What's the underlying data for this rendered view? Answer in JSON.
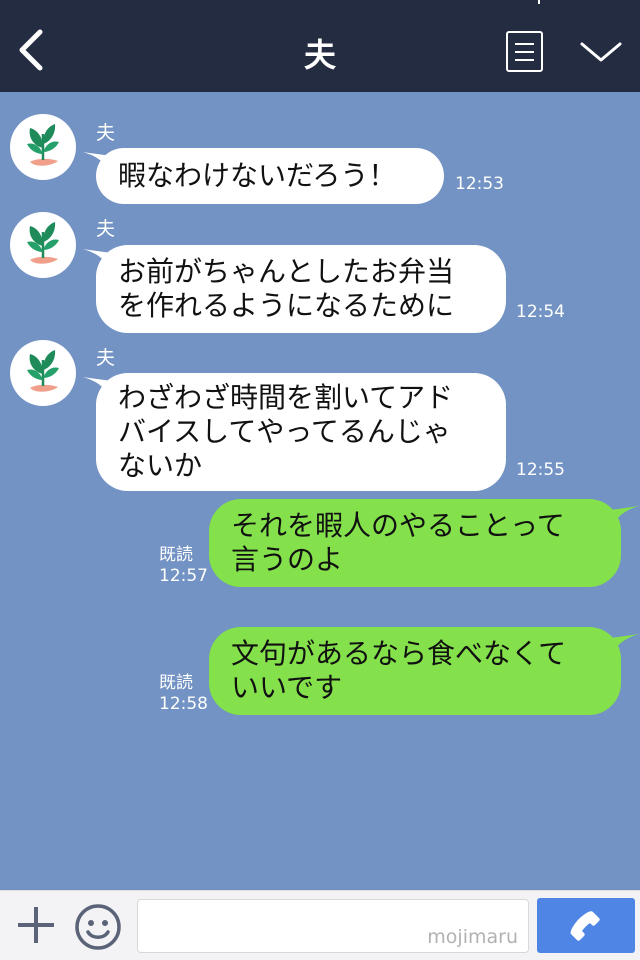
{
  "header": {
    "title": "夫",
    "back_icon": "chevron-left-icon",
    "menu_icon": "list-icon",
    "collapse_icon": "chevron-down-icon"
  },
  "messages": [
    {
      "direction": "in",
      "sender": "夫",
      "text": "暇なわけないだろう！",
      "time": "12:53"
    },
    {
      "direction": "in",
      "sender": "夫",
      "text": "お前がちゃんとしたお弁当\nを作れるようになるために",
      "time": "12:54"
    },
    {
      "direction": "in",
      "sender": "夫",
      "text": "わざわざ時間を割いてアド\nバイスしてやってるんじゃ\nないか",
      "time": "12:55"
    },
    {
      "direction": "out",
      "read": "既読",
      "text": "それを暇人のやることって\n言うのよ",
      "time": "12:57"
    },
    {
      "direction": "out",
      "read": "既読",
      "text": "文句があるなら食べなくて\nいいです",
      "time": "12:58"
    }
  ],
  "input_bar": {
    "placeholder": "",
    "watermark": "mojimaru",
    "plus_icon": "plus-icon",
    "emoji_icon": "smiley-icon",
    "call_icon": "phone-icon"
  },
  "colors": {
    "header_bg": "#242c41",
    "chat_bg": "#7293c3",
    "incoming_bubble": "#ffffff",
    "outgoing_bubble": "#84e14b",
    "call_button": "#4f86e5"
  }
}
